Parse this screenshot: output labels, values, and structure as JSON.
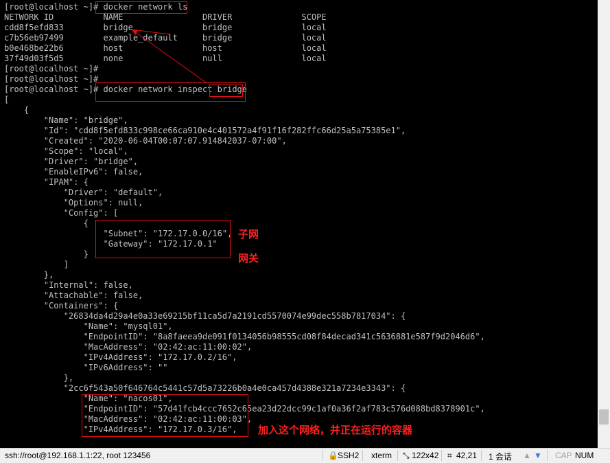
{
  "terminal": {
    "lines": [
      "[root@localhost ~]# docker network ls",
      "NETWORK ID          NAME                DRIVER              SCOPE",
      "cdd8f5efd833        bridge              bridge              local",
      "c7b56eb97499        example_default     bridge              local",
      "b0e468be22b6        host                host                local",
      "37f49d03f5d5        none                null                local",
      "[root@localhost ~]#",
      "[root@localhost ~]#",
      "[root@localhost ~]# docker network inspect bridge",
      "[",
      "    {",
      "        \"Name\": \"bridge\",",
      "        \"Id\": \"cdd8f5efd833c998ce66ca910e4c401572a4f91f16f282ffc66d25a5a75385e1\",",
      "        \"Created\": \"2020-06-04T00:07:07.914842037-07:00\",",
      "        \"Scope\": \"local\",",
      "        \"Driver\": \"bridge\",",
      "        \"EnableIPv6\": false,",
      "        \"IPAM\": {",
      "            \"Driver\": \"default\",",
      "            \"Options\": null,",
      "            \"Config\": [",
      "                {",
      "                    \"Subnet\": \"172.17.0.0/16\",",
      "                    \"Gateway\": \"172.17.0.1\"",
      "                }",
      "            ]",
      "        },",
      "        \"Internal\": false,",
      "        \"Attachable\": false,",
      "        \"Containers\": {",
      "            \"26834da4d29a4e0a33e69215bf11ca5d7a2191cd5570074e99dec558b7817034\": {",
      "                \"Name\": \"mysql01\",",
      "                \"EndpointID\": \"8a8faeea9de091f0134056b98555cd08f84decad341c5636881e587f9d2046d6\",",
      "                \"MacAddress\": \"02:42:ac:11:00:02\",",
      "                \"IPv4Address\": \"172.17.0.2/16\",",
      "                \"IPv6Address\": \"\"",
      "            },",
      "            \"2cc6f543a50f646764c5441c57d5a73226b0a4e0ca457d4388e321a7234e3343\": {",
      "                \"Name\": \"nacos01\",",
      "                \"EndpointID\": \"57d41fcb4ccc7652c65ea23d22dcc99c1af0a36f2af783c576d088bd8378901c\",",
      "                \"MacAddress\": \"02:42:ac:11:00:03\",",
      "                \"IPv4Address\": \"172.17.0.3/16\","
    ]
  },
  "annotations": {
    "subnet_label": "子网",
    "gateway_label": "网关",
    "container_label": "加入这个网络，并正在运行的容器"
  },
  "statusbar": {
    "connection": "ssh://root@192.168.1.1:22, root 123456",
    "protocol": "SSH2",
    "term_type": "xterm",
    "size": "122x42",
    "cursor": "42,21",
    "sessions": "1 会话",
    "caps": "CAP",
    "num": "NUM"
  },
  "colors": {
    "terminal_bg": "#000000",
    "terminal_fg": "#c0c0c0",
    "annotation": "#e01010"
  },
  "icons": [
    "size-icon",
    "cursor-pos-icon",
    "scroll-up-icon",
    "scroll-down-icon"
  ]
}
